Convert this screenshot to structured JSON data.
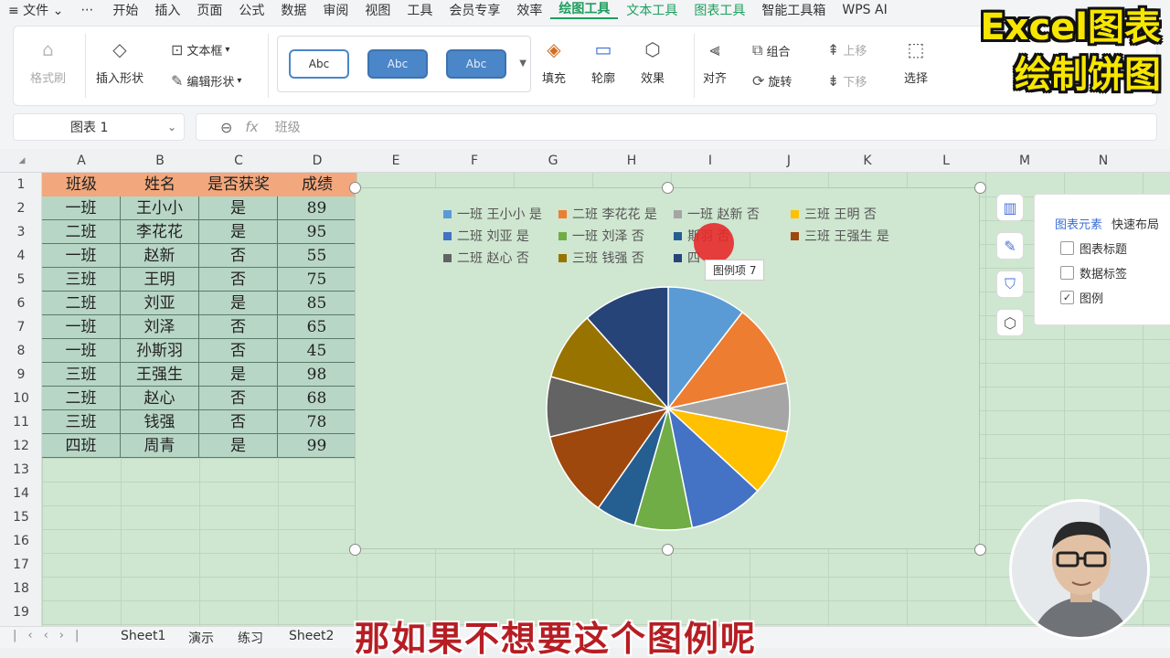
{
  "menu": {
    "items": [
      "≡ 文件 ⌄",
      "⋯",
      "开始",
      "插入",
      "页面",
      "公式",
      "数据",
      "审阅",
      "视图",
      "工具",
      "会员专享",
      "效率",
      "绘图工具",
      "文本工具",
      "图表工具",
      "智能工具箱",
      "WPS AI"
    ],
    "active": "绘图工具"
  },
  "ribbon": {
    "format_brush": "格式刷",
    "insert_shape": "插入形状",
    "text_box": "文本框",
    "edit_shape": "编辑形状",
    "style_samples": [
      "Abc",
      "Abc",
      "Abc"
    ],
    "fill": "填充",
    "outline": "轮廓",
    "effect": "效果",
    "align": "对齐",
    "group": "组合",
    "rotate": "旋转",
    "move_up": "上移",
    "move_down": "下移",
    "select": "选择"
  },
  "formula": {
    "name_box": "图表 1",
    "fx": "fx",
    "content": "班级"
  },
  "columns": [
    "A",
    "B",
    "C",
    "D",
    "E",
    "F",
    "G",
    "H",
    "I",
    "J",
    "K",
    "L",
    "M",
    "N"
  ],
  "rows": [
    "1",
    "2",
    "3",
    "4",
    "5",
    "6",
    "7",
    "8",
    "9",
    "10",
    "11",
    "12",
    "13",
    "14",
    "15",
    "16",
    "17",
    "18",
    "19"
  ],
  "table": {
    "headers": [
      "班级",
      "姓名",
      "是否获奖",
      "成绩"
    ],
    "rows": [
      [
        "一班",
        "王小小",
        "是",
        "89"
      ],
      [
        "二班",
        "李花花",
        "是",
        "95"
      ],
      [
        "一班",
        "赵新",
        "否",
        "55"
      ],
      [
        "三班",
        "王明",
        "否",
        "75"
      ],
      [
        "二班",
        "刘亚",
        "是",
        "85"
      ],
      [
        "一班",
        "刘泽",
        "否",
        "65"
      ],
      [
        "一班",
        "孙斯羽",
        "否",
        "45"
      ],
      [
        "三班",
        "王强生",
        "是",
        "98"
      ],
      [
        "二班",
        "赵心",
        "否",
        "68"
      ],
      [
        "三班",
        "钱强",
        "否",
        "78"
      ],
      [
        "四班",
        "周青",
        "是",
        "99"
      ]
    ]
  },
  "chart_data": {
    "type": "pie",
    "categories": [
      "一班 王小小 是",
      "二班 李花花 是",
      "一班 赵新 否",
      "三班 王明 否",
      "二班 刘亚 是",
      "一班 刘泽 否",
      "一班 孙斯羽 否",
      "三班 王强生 是",
      "二班 赵心 否",
      "三班 钱强 否",
      "四班 周青 是"
    ],
    "values": [
      89,
      95,
      55,
      75,
      85,
      65,
      45,
      98,
      68,
      78,
      99
    ],
    "colors": [
      "#5b9bd5",
      "#ed7d31",
      "#a5a5a5",
      "#ffc000",
      "#4472c4",
      "#70ad47",
      "#255e91",
      "#9e480e",
      "#636363",
      "#997300",
      "#264478"
    ],
    "legend_position": "top"
  },
  "legend_visible": [
    "一班 王小小 是",
    "二班 李花花 是",
    "一班 赵新 否",
    "三班 王明 否",
    "二班 刘亚 是",
    "一班 刘泽 否",
    "斯羽 否",
    "三班 王强生 是",
    "二班 赵心 否",
    "三班 钱强 否",
    "四"
  ],
  "tooltip": "图例项 7",
  "chart_panel": {
    "tabs": [
      "图表元素",
      "快速布局"
    ],
    "options": [
      {
        "label": "图表标题",
        "checked": false
      },
      {
        "label": "数据标签",
        "checked": false
      },
      {
        "label": "图例",
        "checked": true
      }
    ]
  },
  "sheets": [
    "Sheet1",
    "演示",
    "练习",
    "Sheet2"
  ],
  "overlay": {
    "title_line1": "Excel图表",
    "title_line2": "绘制饼图",
    "subtitle": "那如果不想要这个图例呢"
  }
}
